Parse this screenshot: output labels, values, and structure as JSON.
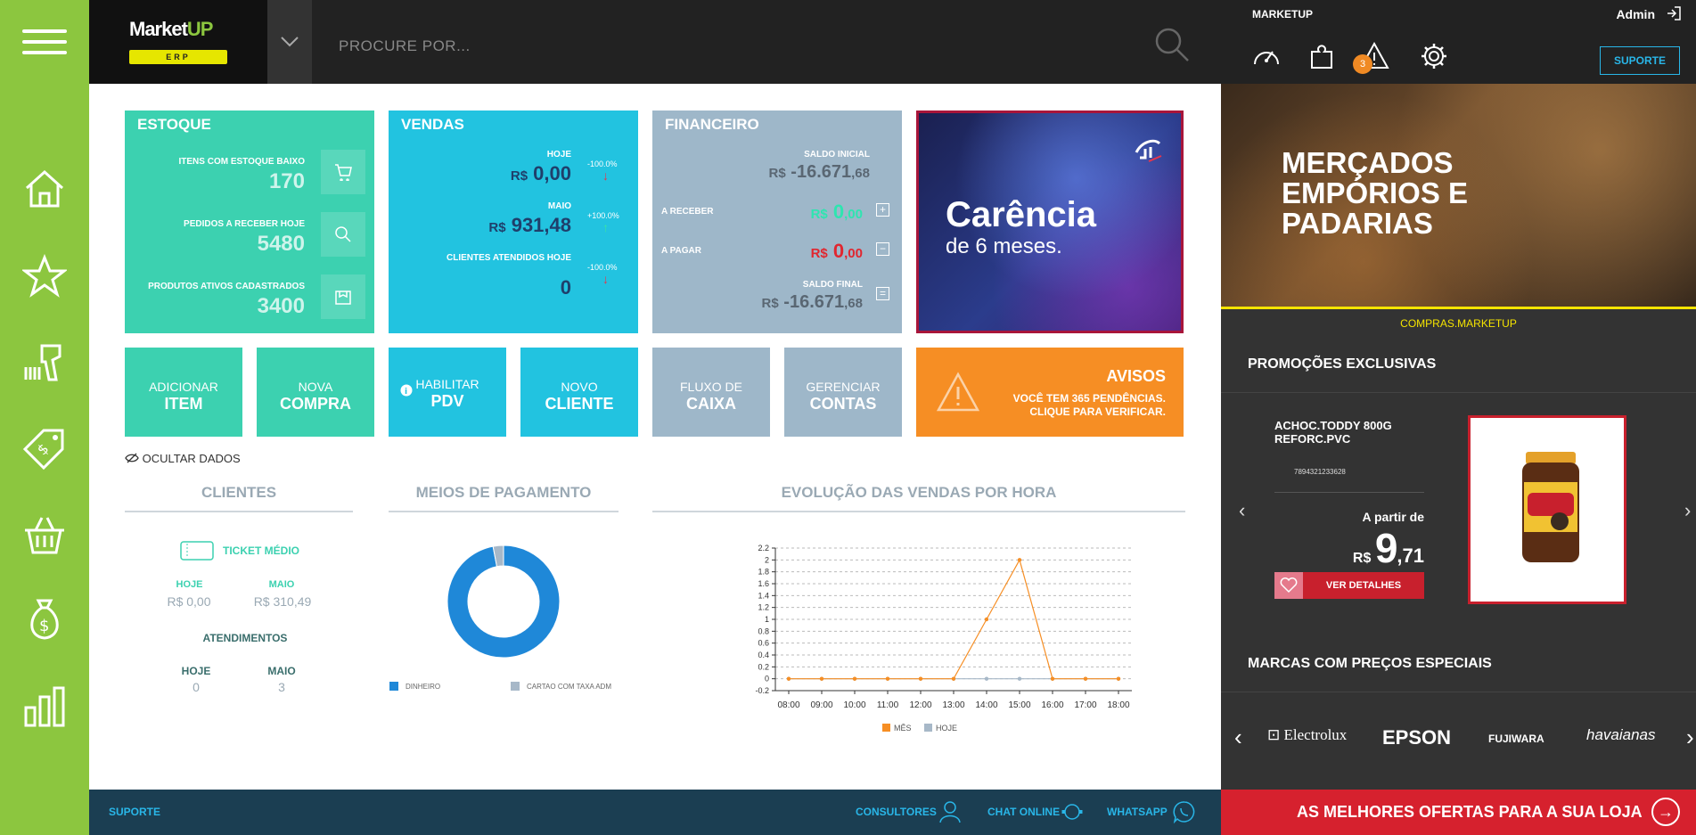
{
  "header": {
    "logo_text": "Market",
    "logo_up": "UP",
    "logo_sub": "ERP",
    "search_placeholder": "PROCURE POR..."
  },
  "right_panel": {
    "title": "MARKETUP",
    "user": "Admin",
    "alert_count": "3",
    "support_label": "SUPORTE",
    "banner_title": "MERÇADOS EMPÓRIOS E PADARIAS",
    "compras_link": "COMPRAS.MARKETUP",
    "promo_title": "PROMOÇÕES EXCLUSIVAS",
    "product": {
      "name": "ACHOC.TODDY 800G REFORC.PVC",
      "code": "7894321233628",
      "from_label": "A partir de",
      "currency": "R$",
      "price_int": "9",
      "price_cents": ",71",
      "details_label": "VER DETALHES"
    },
    "brands_title": "MARCAS COM PREÇOS ESPECIAIS",
    "brands": [
      "Electrolux",
      "EPSON",
      "FUJIWARA",
      "havaianas"
    ],
    "ofertas_label": "AS MELHORES OFERTAS PARA A SUA LOJA"
  },
  "footer": {
    "suporte": "SUPORTE",
    "consultores": "CONSULTORES",
    "chat": "CHAT ONLINE",
    "whatsapp": "WHATSAPP"
  },
  "estoque": {
    "title": "ESTOQUE",
    "rows": [
      {
        "label": "ITENS COM ESTOQUE BAIXO",
        "value": "170"
      },
      {
        "label": "PEDIDOS A RECEBER HOJE",
        "value": "5480"
      },
      {
        "label": "PRODUTOS ATIVOS CADASTRADOS",
        "value": "3400"
      }
    ]
  },
  "vendas": {
    "title": "VENDAS",
    "hoje_label": "HOJE",
    "hoje_value": "0,00",
    "hoje_pct": "-100.0%",
    "maio_label": "MAIO",
    "maio_value": "931,48",
    "maio_pct": "+100.0%",
    "clientes_label": "CLIENTES ATENDIDOS HOJE",
    "clientes_value": "0",
    "clientes_pct": "-100.0%",
    "currency": "R$"
  },
  "financeiro": {
    "title": "FINANCEIRO",
    "saldo_inicial_label": "SALDO INICIAL",
    "saldo_inicial": "-16.671",
    "saldo_inicial_cents": ",68",
    "receber_label": "A RECEBER",
    "receber": "0",
    "receber_cents": ",00",
    "pagar_label": "A PAGAR",
    "pagar": "0",
    "pagar_cents": ",00",
    "saldo_final_label": "SALDO FINAL",
    "saldo_final": "-16.671",
    "saldo_final_cents": ",68",
    "currency": "R$",
    "plus": "+",
    "minus": "−",
    "equals": "="
  },
  "promo_card": {
    "title": "Carência",
    "subtitle": "de 6 meses."
  },
  "actions": [
    {
      "line1": "ADICIONAR",
      "line2": "ITEM"
    },
    {
      "line1": "NOVA",
      "line2": "COMPRA"
    },
    {
      "line1": "HABILITAR",
      "line2": "PDV"
    },
    {
      "line1": "NOVO",
      "line2": "CLIENTE"
    },
    {
      "line1": "FLUXO DE",
      "line2": "CAIXA"
    },
    {
      "line1": "GERENCIAR",
      "line2": "CONTAS"
    }
  ],
  "avisos": {
    "title": "AVISOS",
    "line1": "VOCÊ TEM 365 PENDÊNCIAS.",
    "line2": "CLIQUE PARA VERIFICAR."
  },
  "ocultar_label": "OCULTAR DADOS",
  "clientes": {
    "title": "CLIENTES",
    "ticket_label": "TICKET MÉDIO",
    "hoje_label": "HOJE",
    "hoje_value": "R$ 0,00",
    "maio_label": "MAIO",
    "maio_value": "R$ 310,49",
    "atendimentos_label": "ATENDIMENTOS",
    "at_hoje_label": "HOJE",
    "at_hoje_value": "0",
    "at_maio_label": "MAIO",
    "at_maio_value": "3"
  },
  "pagamento": {
    "title": "MEIOS DE PAGAMENTO",
    "legend": [
      "DINHEIRO",
      "CARTAO COM TAXA ADM"
    ]
  },
  "evolucao": {
    "title": "EVOLUÇÃO DAS VENDAS POR HORA"
  },
  "chart_data": [
    {
      "type": "pie",
      "labels": [
        "DINHEIRO",
        "CARTAO COM TAXA ADM"
      ],
      "values": [
        97,
        3
      ],
      "colors": [
        "#1f88d8",
        "#a7b8c8"
      ],
      "donut": true
    },
    {
      "type": "line",
      "categories": [
        "08:00",
        "09:00",
        "10:00",
        "11:00",
        "12:00",
        "13:00",
        "14:00",
        "15:00",
        "16:00",
        "17:00",
        "18:00"
      ],
      "series": [
        {
          "name": "MÊS",
          "color": "#f68e24",
          "values": [
            0,
            0,
            0,
            0,
            0,
            0,
            1,
            2,
            0,
            0,
            0
          ]
        },
        {
          "name": "HOJE",
          "color": "#a7b8c8",
          "values": [
            0,
            0,
            0,
            0,
            0,
            0,
            0,
            0,
            0,
            0,
            0
          ]
        }
      ],
      "yticks": [
        "-0.2",
        "0",
        "0.2",
        "0.4",
        "0.6",
        "0.8",
        "1",
        "1.2",
        "1.4",
        "1.6",
        "1.8",
        "2",
        "2.2"
      ],
      "ylim": [
        -0.2,
        2.2
      ],
      "grid": true,
      "legend": "bottom"
    }
  ]
}
